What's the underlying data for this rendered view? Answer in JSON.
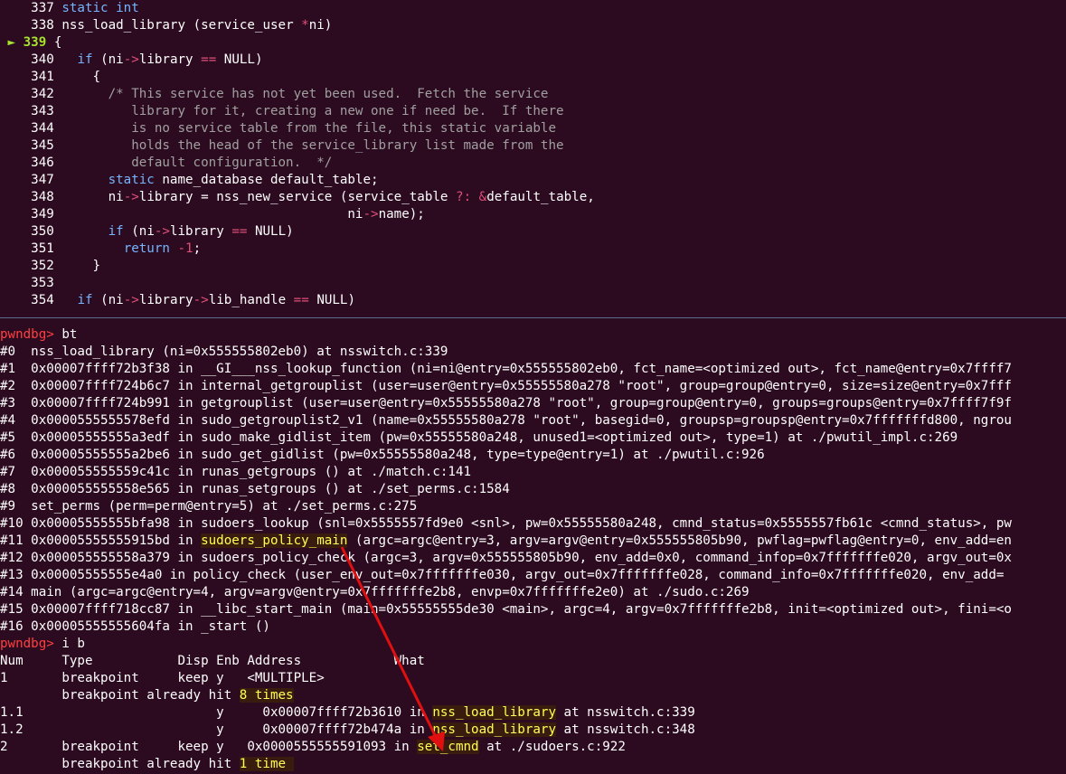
{
  "colors": {
    "background": "#2c0a1f",
    "text": "#ffffff",
    "keyword": "#75b5ff",
    "operator": "#e0507a",
    "comment": "#a0a0a0",
    "current_marker": "#a6e22e",
    "prompt": "#ff4040",
    "highlight_text": "#ffff55",
    "highlight_bg": "#3a1c0e",
    "arrow": "#e01010"
  },
  "source": [
    {
      "ln": "337",
      "marker": "",
      "text": "static int"
    },
    {
      "ln": "338",
      "marker": "",
      "text": "nss_load_library (service_user *ni)"
    },
    {
      "ln": "339",
      "marker": "►",
      "text": "{"
    },
    {
      "ln": "340",
      "marker": "",
      "text": "  if (ni->library == NULL)"
    },
    {
      "ln": "341",
      "marker": "",
      "text": "    {"
    },
    {
      "ln": "342",
      "marker": "",
      "text": "      /* This service has not yet been used.  Fetch the service"
    },
    {
      "ln": "343",
      "marker": "",
      "text": "         library for it, creating a new one if need be.  If there"
    },
    {
      "ln": "344",
      "marker": "",
      "text": "         is no service table from the file, this static variable"
    },
    {
      "ln": "345",
      "marker": "",
      "text": "         holds the head of the service_library list made from the"
    },
    {
      "ln": "346",
      "marker": "",
      "text": "         default configuration.  */"
    },
    {
      "ln": "347",
      "marker": "",
      "text": "      static name_database default_table;"
    },
    {
      "ln": "348",
      "marker": "",
      "text": "      ni->library = nss_new_service (service_table ?: &default_table,"
    },
    {
      "ln": "349",
      "marker": "",
      "text": "                                     ni->name);"
    },
    {
      "ln": "350",
      "marker": "",
      "text": "      if (ni->library == NULL)"
    },
    {
      "ln": "351",
      "marker": "",
      "text": "        return -1;"
    },
    {
      "ln": "352",
      "marker": "",
      "text": "    }"
    },
    {
      "ln": "353",
      "marker": "",
      "text": ""
    },
    {
      "ln": "354",
      "marker": "",
      "text": "  if (ni->library->lib_handle == NULL)"
    }
  ],
  "prompt": "pwndbg>",
  "cmd_bt": "bt",
  "backtrace": [
    "#0  nss_load_library (ni=0x555555802eb0) at nsswitch.c:339",
    "#1  0x00007ffff72b3f38 in __GI___nss_lookup_function (ni=ni@entry=0x555555802eb0, fct_name=<optimized out>, fct_name@entry=0x7ffff7",
    "#2  0x00007ffff724b6c7 in internal_getgrouplist (user=user@entry=0x55555580a278 \"root\", group=group@entry=0, size=size@entry=0x7fff",
    "#3  0x00007ffff724b991 in getgrouplist (user=user@entry=0x55555580a278 \"root\", group=group@entry=0, groups=groups@entry=0x7ffff7f9f",
    "#4  0x0000555555578efd in sudo_getgrouplist2_v1 (name=0x55555580a278 \"root\", basegid=0, groupsp=groupsp@entry=0x7fffffffd800, ngrou",
    "#5  0x00005555555a3edf in sudo_make_gidlist_item (pw=0x55555580a248, unused1=<optimized out>, type=1) at ./pwutil_impl.c:269",
    "#6  0x00005555555a2be6 in sudo_get_gidlist (pw=0x55555580a248, type=type@entry=1) at ./pwutil.c:926",
    "#7  0x000055555559c41c in runas_getgroups () at ./match.c:141",
    "#8  0x000055555558e565 in runas_setgroups () at ./set_perms.c:1584",
    "#9  set_perms (perm=perm@entry=5) at ./set_perms.c:275",
    "#10 0x00005555555bfa98 in sudoers_lookup (snl=0x5555557fd9e0 <snl>, pw=0x55555580a248, cmnd_status=0x5555557fb61c <cmnd_status>, pw",
    "#11 0x00005555555915bd in sudoers_policy_main (argc=argc@entry=3, argv=argv@entry=0x555555805b90, pwflag=pwflag@entry=0, env_add=en",
    "#12 0x000055555558a379 in sudoers_policy_check (argc=3, argv=0x555555805b90, env_add=0x0, command_infop=0x7fffffffe020, argv_out=0x",
    "#13 0x00005555555e4a0 in policy_check (user_env_out=0x7fffffffe030, argv_out=0x7fffffffe028, command_info=0x7fffffffe020, env_add=",
    "#14 main (argc=argc@entry=4, argv=argv@entry=0x7fffffffe2b8, envp=0x7fffffffe2e0) at ./sudo.c:269",
    "#15 0x00007ffff718cc87 in __libc_start_main (main=0x55555555de30 <main>, argc=4, argv=0x7fffffffe2b8, init=<optimized out>, fini=<o",
    "#16 0x00005555555604fa in _start ()"
  ],
  "bt_highlight": "sudoers_policy_main",
  "cmd_ib": "i b",
  "ib_header": "Num     Type           Disp Enb Address            What",
  "ib_rows": [
    {
      "pre": "1       breakpoint     keep y   <MULTIPLE>",
      "hl": "",
      "post": ""
    },
    {
      "pre": "        breakpoint already hit ",
      "hl": "8 times",
      "post": ""
    },
    {
      "pre": "1.1                         y     0x00007ffff72b3610 in ",
      "hl": "nss_load_library",
      "post": " at nsswitch.c:339"
    },
    {
      "pre": "1.2                         y     0x00007ffff72b474a in ",
      "hl": "nss_load_library",
      "post": " at nsswitch.c:348"
    },
    {
      "pre": "2       breakpoint     keep y   0x0000555555591093 in ",
      "hl": "set_cmnd",
      "post": " at ./sudoers.c:922"
    },
    {
      "pre": "        breakpoint already hit ",
      "hl": "1 time ",
      "post": ""
    }
  ]
}
